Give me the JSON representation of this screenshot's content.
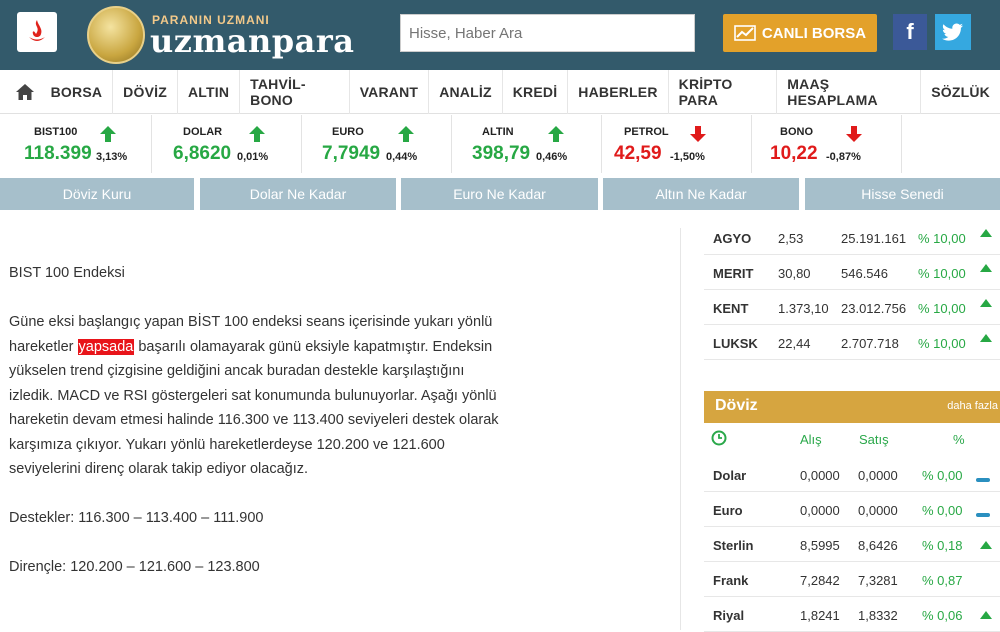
{
  "brand": {
    "tagline": "PARANIN UZMANI",
    "name": "uzmanpara"
  },
  "search": {
    "placeholder": "Hisse, Haber Ara"
  },
  "live_button": "CANLI BORSA",
  "social": {
    "facebook": "f"
  },
  "nav": [
    "BORSA",
    "DÖVİZ",
    "ALTIN",
    "TAHVİL-BONO",
    "VARANT",
    "ANALİZ",
    "KREDİ",
    "HABERLER",
    "KRİPTO PARA",
    "MAAŞ HESAPLAMA",
    "SÖZLÜK"
  ],
  "ticker": [
    {
      "name": "BIST100",
      "value": "118.399",
      "pct": "3,13%",
      "direction": "up"
    },
    {
      "name": "DOLAR",
      "value": "6,8620",
      "pct": "0,01%",
      "direction": "up"
    },
    {
      "name": "EURO",
      "value": "7,7949",
      "pct": "0,44%",
      "direction": "up"
    },
    {
      "name": "ALTIN",
      "value": "398,79",
      "pct": "0,46%",
      "direction": "up"
    },
    {
      "name": "PETROL",
      "value": "42,59",
      "pct": "-1,50%",
      "direction": "down"
    },
    {
      "name": "BONO",
      "value": "10,22",
      "pct": "-0,87%",
      "direction": "down"
    }
  ],
  "quick_links": [
    "Döviz Kuru",
    "Dolar Ne Kadar",
    "Euro Ne Kadar",
    "Altın Ne Kadar",
    "Hisse Senedi"
  ],
  "article": {
    "heading": "BIST 100 Endeksi",
    "para_before": "Güne eksi başlangıç yapan BİST 100 endeksi seans içerisinde yukarı yönlü hareketler ",
    "highlight": "yapsada",
    "para_after": " başarılı olamayarak günü eksiyle kapatmıştır. Endeksin yükselen trend çizgisine geldiğini ancak buradan destekle karşılaştığını izledik. MACD ve RSI göstergeleri sat konumunda bulunuyorlar. Aşağı yönlü hareketin devam etmesi halinde 116.300 ve 113.400 seviyeleri destek olarak karşımıza çıkıyor. Yukarı yönlü hareketlerdeyse 120.200 ve 121.600 seviyelerini direnç olarak takip ediyor olacağız.",
    "supports": "Destekler: 116.300 – 113.400 – 111.900",
    "resistances": "Dirençle: 120.200 – 121.600 – 123.800"
  },
  "hisse_rows": [
    {
      "code": "AGYO",
      "price": "2,53",
      "volume": "25.191.161",
      "pct": "% 10,00"
    },
    {
      "code": "MERIT",
      "price": "30,80",
      "volume": "546.546",
      "pct": "% 10,00"
    },
    {
      "code": "KENT",
      "price": "1.373,10",
      "volume": "23.012.756",
      "pct": "% 10,00"
    },
    {
      "code": "LUKSK",
      "price": "22,44",
      "volume": "2.707.718",
      "pct": "% 10,00"
    }
  ],
  "doviz": {
    "title": "Döviz",
    "more": "daha fazla",
    "columns": {
      "buy": "Alış",
      "sell": "Satış",
      "pct": "%"
    },
    "rows": [
      {
        "name": "Dolar",
        "buy": "0,0000",
        "sell": "0,0000",
        "pct": "% 0,00",
        "trend": "flat"
      },
      {
        "name": "Euro",
        "buy": "0,0000",
        "sell": "0,0000",
        "pct": "% 0,00",
        "trend": "flat"
      },
      {
        "name": "Sterlin",
        "buy": "8,5995",
        "sell": "8,6426",
        "pct": "% 0,18",
        "trend": "up"
      },
      {
        "name": "Frank",
        "buy": "7,2842",
        "sell": "7,3281",
        "pct": "% 0,87",
        "trend": ""
      },
      {
        "name": "Riyal",
        "buy": "1,8241",
        "sell": "1,8332",
        "pct": "% 0,06",
        "trend": "up"
      }
    ]
  },
  "colors": {
    "up": "#27a844",
    "down": "#e01b1b",
    "header": "#335a6b",
    "accent": "#e3a12a",
    "quick": "#a6bfcb"
  }
}
